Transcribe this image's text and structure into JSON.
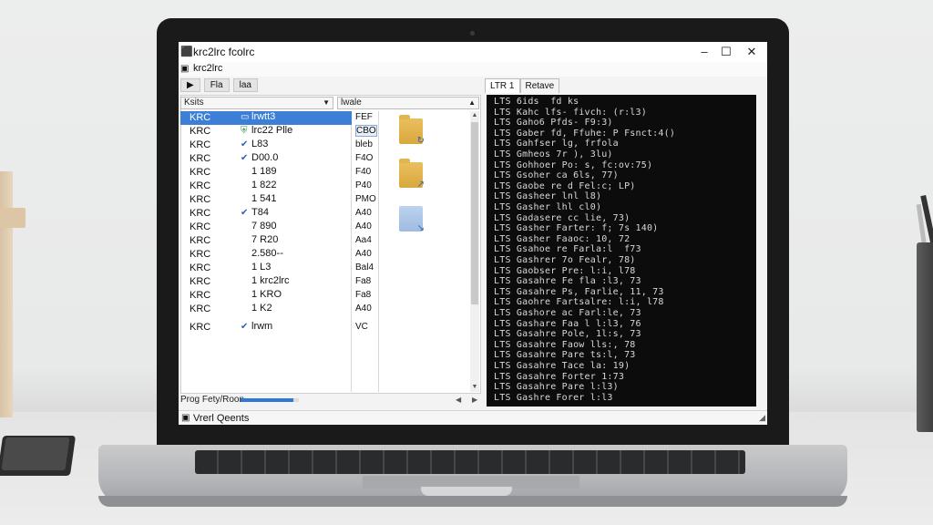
{
  "window": {
    "title": "krc2lrc fcolrc",
    "menu_label": "krc2lrc",
    "controls": {
      "minimize": "–",
      "maximize": "☐",
      "close": "✕"
    }
  },
  "toolbar": {
    "buttons": [
      {
        "label": "▶",
        "icon": "play-icon"
      },
      {
        "label": "Fla"
      },
      {
        "label": "laa"
      }
    ]
  },
  "path_bar": {
    "left_value": "Ksits",
    "right_value": "lwale"
  },
  "file_list": [
    {
      "a": "KRC",
      "b": "lrwtt3",
      "c": "FEF",
      "icon": "file-icon",
      "selected": true
    },
    {
      "a": "KRC",
      "b": "lrc22 Plle",
      "c": "CBO",
      "icon": "shield-icon"
    },
    {
      "a": "KRC",
      "b": "L83",
      "c": "bleb",
      "icon": "check-icon"
    },
    {
      "a": "KRC",
      "b": "D00.0",
      "c": "F4O",
      "icon": "check-icon"
    },
    {
      "a": "KRC",
      "b": "1 189",
      "c": "F40"
    },
    {
      "a": "KRC",
      "b": "1 822",
      "c": "P40"
    },
    {
      "a": "KRC",
      "b": "1 541",
      "c": "PMO"
    },
    {
      "a": "KRC",
      "b": "T84",
      "c": "A40",
      "icon": "check-icon"
    },
    {
      "a": "KRC",
      "b": "7 890",
      "c": "A40"
    },
    {
      "a": "KRC",
      "b": "7 R20",
      "c": "Aa4"
    },
    {
      "a": "KRC",
      "b": "2.580--",
      "c": "A40"
    },
    {
      "a": "KRC",
      "b": "1 L3",
      "c": "Bal4"
    },
    {
      "a": "KRC",
      "b": "1 krc2lrc",
      "c": "Fa8"
    },
    {
      "a": "KRC",
      "b": "1 KRO",
      "c": "Fa8"
    },
    {
      "a": "KRC",
      "b": "1 K2",
      "c": "A40"
    },
    {
      "a": "KRC",
      "b": "lrwm",
      "c": "VC",
      "icon": "check-icon"
    }
  ],
  "icon_pane": [
    {
      "icon": "folder-icon",
      "badge": "↻"
    },
    {
      "icon": "folder-icon",
      "badge": "↗"
    },
    {
      "icon": "document-icon",
      "badge": "↘"
    }
  ],
  "status": {
    "label": "Prog Fety/Roon",
    "progress": 0.9
  },
  "bottom_status": {
    "label": "Vrerl Qeents"
  },
  "tabs": [
    {
      "label": "LTR 1",
      "active": true
    },
    {
      "label": "Retave"
    }
  ],
  "terminal": {
    "lines": [
      "LTS 6ids  fd ks",
      "LTS Kahc lfs- fivch: (r:l3)",
      "LTS Gaho6 Pfds- F9:3)",
      "LTS Gaber fd, Ffuhe: P Fsnct:4()",
      "LTS Gahfser lg, frfola",
      "LTS Gmheos 7r ), 3lu)",
      "LTS Gohhoer Po: s, fc:ov:75)",
      "LTS Gsoher ca 6ls, 77)",
      "LTS Gaobe re d Fel:c; LP)",
      "LTS Gasheer lnl l8)",
      "LTS Gasher lhl cl0)",
      "LTS Gadasere cc lie, 73)",
      "LTS Gasher Farter: f; 7s 140)",
      "LTS Gasher Faaoc: 10, 72",
      "LTS Gsahoe re Farla:l  f73",
      "LTS Gashrer 7o Fealr, 78)",
      "LTS Gaobser Pre: l:i, l78",
      "LTS Gasahre Fe fla :l3, 73",
      "LTS Gasahre Ps, Farlie, 11, 73",
      "LTS Gaohre Fartsalre: l:i, l78",
      "LTS Gashore ac Farl:le, 73",
      "LTS Gashare Faa l l:l3, 76",
      "LTS Gasahre Pole, 1l:s, 73",
      "LTS Gasahre Faow lls:, 78",
      "LTS Gasahre Pare ts:l, 73",
      "LTS Gasahre Tace la: 19)",
      "LTS Gasahre Forter 1:73",
      "LTS Gasahre Pare l:l3)",
      "LTS Gashre Forer l:l3"
    ]
  }
}
